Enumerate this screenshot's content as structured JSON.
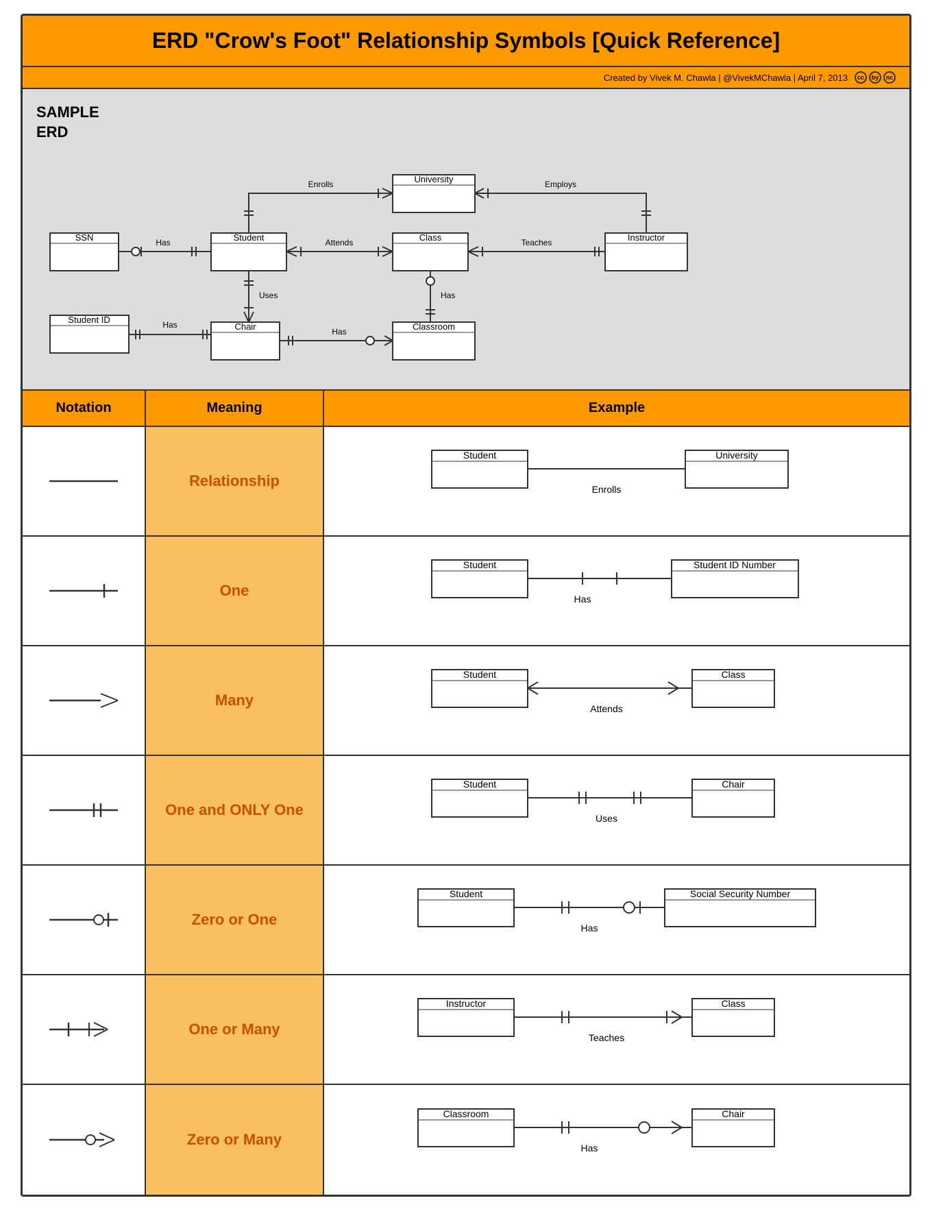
{
  "title": "ERD \"Crow's Foot\" Relationship Symbols [Quick Reference]",
  "attribution": {
    "text": "Created by Vivek M. Chawla  |  @VivekMChawla  |  April 7, 2013"
  },
  "erd_label": "SAMPLE\nERD",
  "table": {
    "headers": [
      "Notation",
      "Meaning",
      "Example"
    ],
    "rows": [
      {
        "meaning": "Relationship",
        "example_left": "Student",
        "example_right": "University",
        "example_label": "Enrolls"
      },
      {
        "meaning": "One",
        "example_left": "Student",
        "example_right": "Student ID Number",
        "example_label": "Has"
      },
      {
        "meaning": "Many",
        "example_left": "Student",
        "example_right": "Class",
        "example_label": "Attends"
      },
      {
        "meaning": "One and ONLY One",
        "example_left": "Student",
        "example_right": "Chair",
        "example_label": "Uses"
      },
      {
        "meaning": "Zero or One",
        "example_left": "Student",
        "example_right": "Social Security Number",
        "example_label": "Has"
      },
      {
        "meaning": "One or Many",
        "example_left": "Instructor",
        "example_right": "Class",
        "example_label": "Teaches"
      },
      {
        "meaning": "Zero or Many",
        "example_left": "Classroom",
        "example_right": "Chair",
        "example_label": "Has"
      }
    ]
  }
}
